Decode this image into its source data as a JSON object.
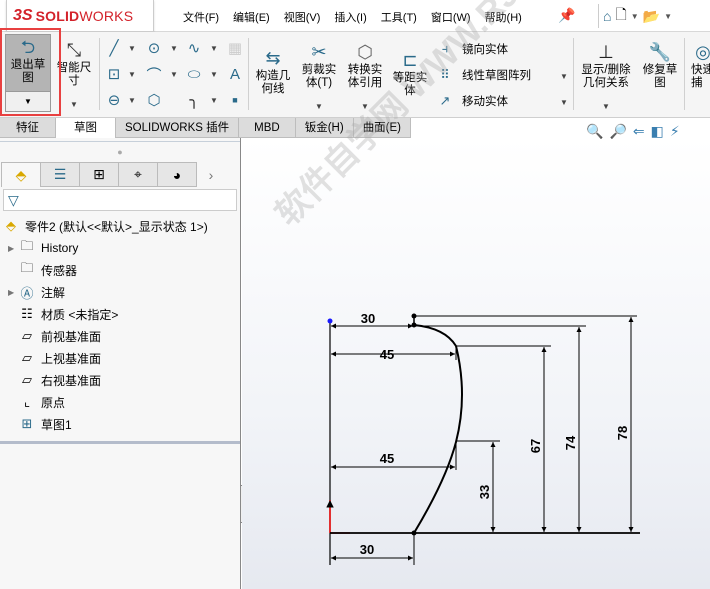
{
  "app": {
    "logo_prefix": "3S",
    "logo_bold": "SOLID",
    "logo_light": "WORKS"
  },
  "menu": [
    "文件(F)",
    "编辑(E)",
    "视图(V)",
    "插入(I)",
    "工具(T)",
    "窗口(W)",
    "帮助(H)"
  ],
  "quick_access": {
    "home": "⌂",
    "new": "🗋",
    "open": "📂"
  },
  "ribbon": {
    "exit_sketch": "退出草图",
    "smart_dim": "智能尺寸",
    "construction": "构造几何线",
    "trim": "剪裁实体(T)",
    "convert": "转换实体引用",
    "offset": "等距实体",
    "mirror": "镜向实体",
    "linear_pattern": "线性草图阵列",
    "move": "移动实体",
    "relations": "显示/删除几何关系",
    "repair": "修复草图",
    "quick": "快速捕"
  },
  "tabs": [
    {
      "label": "特征",
      "active": false
    },
    {
      "label": "草图",
      "active": true
    },
    {
      "label": "SOLIDWORKS 插件",
      "active": false
    },
    {
      "label": "MBD",
      "active": false
    },
    {
      "label": "钣金(H)",
      "active": false
    },
    {
      "label": "曲面(E)",
      "active": false
    }
  ],
  "tree": {
    "root": "零件2  (默认<<默认>_显示状态 1>)",
    "items": [
      {
        "label": "History",
        "icon": "history",
        "expandable": true
      },
      {
        "label": "传感器",
        "icon": "sensor",
        "expandable": false
      },
      {
        "label": "注解",
        "icon": "annotation",
        "expandable": true
      },
      {
        "label": "材质 <未指定>",
        "icon": "material",
        "expandable": false
      },
      {
        "label": "前视基准面",
        "icon": "plane",
        "expandable": false
      },
      {
        "label": "上视基准面",
        "icon": "plane",
        "expandable": false
      },
      {
        "label": "右视基准面",
        "icon": "plane",
        "expandable": false
      },
      {
        "label": "原点",
        "icon": "origin",
        "expandable": false
      },
      {
        "label": "草图1",
        "icon": "sketch",
        "expandable": false
      }
    ]
  },
  "sketch": {
    "dimensions": {
      "top_width": "30",
      "upper_width": "45",
      "lower_width": "45",
      "bottom_width": "30",
      "h33": "33",
      "h67": "67",
      "h74": "74",
      "h78": "78"
    }
  },
  "watermark": "软件自学网 WWW.RJZXW.COM"
}
